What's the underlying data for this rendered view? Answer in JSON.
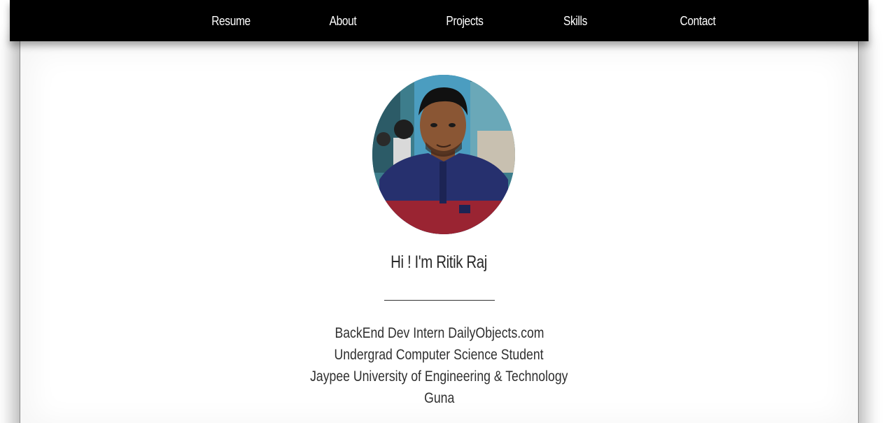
{
  "nav": {
    "items": [
      {
        "label": "Resume"
      },
      {
        "label": "About"
      },
      {
        "label": "Projects"
      },
      {
        "label": "Skills"
      },
      {
        "label": "Contact"
      }
    ]
  },
  "profile": {
    "greeting": "Hi ! I'm Ritik Raj",
    "bio_lines": [
      "BackEnd Dev Intern DailyObjects.com",
      "Undergrad Computer Science Student",
      "Jaypee University of Engineering & Technology",
      "Guna"
    ]
  },
  "colors": {
    "nav_background": "#000000",
    "nav_text": "#ffffff",
    "page_background": "#ffffff",
    "text": "#2f2f2f"
  }
}
